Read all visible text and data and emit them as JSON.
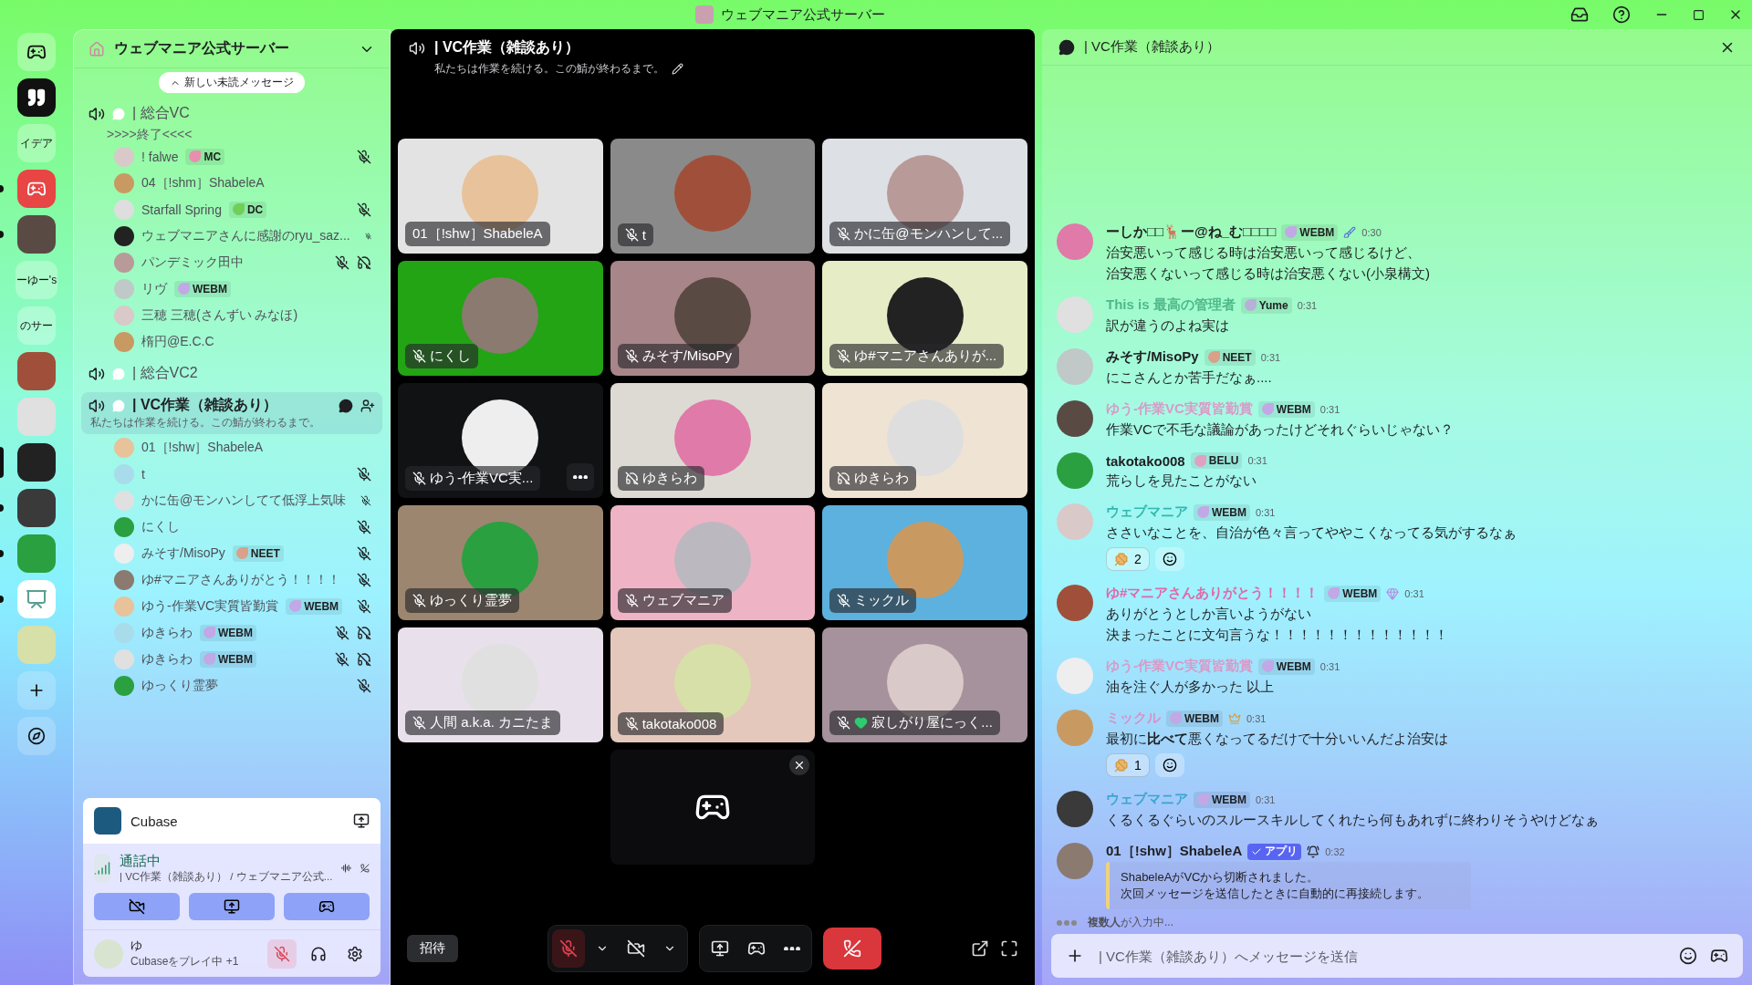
{
  "window": {
    "title": "ウェブマニア公式サーバー"
  },
  "server_rail": {
    "items": [
      {
        "kind": "logo",
        "unread": false,
        "selected": false
      },
      {
        "kind": "quote",
        "unread": false,
        "selected": false
      },
      {
        "kind": "text",
        "label": "イデア",
        "unread": false,
        "selected": false
      },
      {
        "kind": "discord",
        "unread": true,
        "selected": false
      },
      {
        "kind": "picture",
        "unread": true,
        "selected": false
      },
      {
        "kind": "text",
        "label": "ーゆー's",
        "unread": false,
        "selected": false
      },
      {
        "kind": "text",
        "label": "のサー",
        "unread": false,
        "selected": false
      },
      {
        "kind": "picture",
        "unread": false,
        "selected": false
      },
      {
        "kind": "picture",
        "unread": false,
        "selected": false
      },
      {
        "kind": "picture",
        "unread": false,
        "selected": true
      },
      {
        "kind": "picture",
        "unread": true,
        "selected": false
      },
      {
        "kind": "picture",
        "unread": true,
        "selected": false
      },
      {
        "kind": "easel",
        "unread": true,
        "selected": false
      },
      {
        "kind": "picture",
        "unread": false,
        "selected": false
      },
      {
        "kind": "add",
        "unread": false,
        "selected": false
      },
      {
        "kind": "explore",
        "unread": false,
        "selected": false
      }
    ]
  },
  "sidebar": {
    "server_name": "ウェブマニア公式サーバー",
    "unread_pill": "新しい未読メッセージ",
    "channels": [
      {
        "name": "| 総合VC",
        "status": ">>>>終了<<<<",
        "selected": false,
        "members": [
          {
            "name": "! falwe",
            "badge": {
              "kind": "role",
              "label": "MC",
              "color": "#e88fb0"
            },
            "muted": true,
            "deafened": false
          },
          {
            "name": "04［!shm］ShabeleA",
            "muted": false,
            "deafened": false
          },
          {
            "name": "Starfall Spring",
            "badge": {
              "kind": "role",
              "label": "DC",
              "color": "#6fcf5a"
            },
            "muted": true,
            "deafened": false
          },
          {
            "name": "ウェブマニアさんに感謝のryu_saz...",
            "muted": true,
            "deafened": false
          },
          {
            "name": "パンデミック田中",
            "muted": true,
            "deafened": true
          },
          {
            "name": "リヴ",
            "badge": {
              "kind": "role",
              "label": "WEBM",
              "color": "#c2a8e6"
            },
            "muted": false,
            "deafened": false
          },
          {
            "name": "三穂 三穂(さんずい みなほ)",
            "muted": false,
            "deafened": false
          },
          {
            "name": "楕円@E.C.C",
            "muted": false,
            "deafened": false
          }
        ]
      },
      {
        "name": "| 総合VC2",
        "selected": false
      },
      {
        "name": "| VC作業（雑談あり）",
        "status": "私たちは作業を続ける。この鯖が終わるまで。",
        "selected": true,
        "members": [
          {
            "name": "01［!shw］ShabeleA",
            "muted": false,
            "deafened": false
          },
          {
            "name": "t",
            "muted": true,
            "deafened": false
          },
          {
            "name": "かに缶@モンハンしてて低浮上気味",
            "muted": true,
            "deafened": false
          },
          {
            "name": "にくし",
            "muted": true,
            "deafened": false
          },
          {
            "name": "みそす/MisoPy",
            "badge": {
              "kind": "role",
              "label": "NEET",
              "color": "#d9a08a"
            },
            "muted": true,
            "deafened": false
          },
          {
            "name": "ゆ#マニアさんありがとう！！！！",
            "muted": true,
            "deafened": false
          },
          {
            "name": "ゆう-作業VC実質皆勤賞",
            "badge": {
              "kind": "role",
              "label": "WEBM",
              "color": "#c2a8e6"
            },
            "muted": true,
            "deafened": false
          },
          {
            "name": "ゆきらわ",
            "badge": {
              "kind": "role",
              "label": "WEBM",
              "color": "#c2a8e6"
            },
            "muted": true,
            "deafened": true
          },
          {
            "name": "ゆきらわ",
            "badge": {
              "kind": "role",
              "label": "WEBM",
              "color": "#c2a8e6"
            },
            "muted": true,
            "deafened": true
          },
          {
            "name": "ゆっくり霊夢",
            "muted": true,
            "deafened": false
          }
        ]
      }
    ],
    "activity": {
      "name": "Cubase"
    },
    "voice_status": {
      "title": "通話中",
      "location": "| VC作業（雑談あり） / ウェブマニア公式..."
    },
    "user": {
      "name": "ゆ",
      "status": "Cubaseをプレイ中 +1",
      "mic_muted": true
    }
  },
  "video": {
    "title": "| VC作業（雑談あり）",
    "topic": "私たちは作業を続ける。この鯖が終わるまで。",
    "tiles": [
      {
        "name": "01［!shw］ShabeleA",
        "muted": false,
        "deafened": false,
        "heart": false,
        "color": "#e3e3e3",
        "more_button": false
      },
      {
        "name": "t",
        "muted": true,
        "deafened": false,
        "heart": false,
        "color": "#8a8a8a",
        "more_button": false
      },
      {
        "name": "かに缶@モンハンして...",
        "muted": true,
        "deafened": false,
        "heart": false,
        "color": "#dde0e4",
        "more_button": false
      },
      {
        "name": "にくし",
        "muted": true,
        "deafened": false,
        "heart": false,
        "color": "#22a414",
        "more_button": false
      },
      {
        "name": "みそす/MisoPy",
        "muted": true,
        "deafened": false,
        "heart": false,
        "color": "#a88589",
        "more_button": false
      },
      {
        "name": "ゆ#マニアさんありが...",
        "muted": true,
        "deafened": false,
        "heart": false,
        "color": "#e6ecc6",
        "more_button": false
      },
      {
        "name": "ゆう-作業VC実...",
        "muted": true,
        "deafened": false,
        "heart": false,
        "color": "#111214",
        "more_button": true
      },
      {
        "name": "ゆきらわ",
        "muted": false,
        "deafened": true,
        "heart": false,
        "color": "#dddad4",
        "more_button": false
      },
      {
        "name": "ゆきらわ",
        "muted": false,
        "deafened": true,
        "heart": false,
        "color": "#efe3d4",
        "more_button": false
      },
      {
        "name": "ゆっくり霊夢",
        "muted": true,
        "deafened": false,
        "heart": false,
        "color": "#9c8670",
        "more_button": false
      },
      {
        "name": "ウェブマニア",
        "muted": true,
        "deafened": false,
        "heart": false,
        "color": "#efb3c6",
        "more_button": false
      },
      {
        "name": "ミックル",
        "muted": true,
        "deafened": false,
        "heart": false,
        "color": "#5cb1de",
        "more_button": false
      },
      {
        "name": "人間 a.k.a. カニたま",
        "muted": true,
        "deafened": false,
        "heart": false,
        "color": "#e8e0ea",
        "more_button": false
      },
      {
        "name": "takotako008",
        "muted": true,
        "deafened": false,
        "heart": false,
        "color": "#e4c8bb",
        "more_button": false
      },
      {
        "name": "寂しがり屋にっく...",
        "muted": true,
        "deafened": false,
        "heart": true,
        "color": "#a6929c",
        "more_button": false
      }
    ],
    "controls": {
      "invite": "招待",
      "mic_muted": true
    }
  },
  "chat": {
    "title": "| VC作業（雑談あり）",
    "messages": [
      {
        "author": "ーしか□□🦌ー@ね_む□□□□",
        "color": "#1e1f22",
        "badge": {
          "kind": "role",
          "label": "WEBM",
          "color": "#c2a8e6"
        },
        "brush": true,
        "gem": false,
        "crown": false,
        "bell": false,
        "time": "0:30",
        "lines": [
          "治安悪いって感じる時は治安悪いって感じるけど、",
          "治安悪くないって感じる時は治安悪くない(小泉構文)"
        ]
      },
      {
        "author": "This is 最高の管理者",
        "color": "#4fb88a",
        "badge": {
          "kind": "role",
          "label": "Yume",
          "color": "#b8b0d8"
        },
        "brush": false,
        "gem": false,
        "crown": false,
        "bell": false,
        "time": "0:31",
        "lines": [
          "訳が違うのよね実は"
        ]
      },
      {
        "author": "みそす/MisoPy",
        "color": "#1e1f22",
        "badge": {
          "kind": "role",
          "label": "NEET",
          "color": "#d9a08a"
        },
        "brush": false,
        "gem": false,
        "crown": false,
        "bell": false,
        "time": "0:31",
        "lines": [
          "にこさんとか苦手だなぁ...."
        ]
      },
      {
        "author": "ゆう-作業VC実質皆勤賞",
        "color": "#d99ac8",
        "badge": {
          "kind": "role",
          "label": "WEBM",
          "color": "#c2a8e6"
        },
        "brush": false,
        "gem": false,
        "crown": false,
        "bell": false,
        "time": "0:31",
        "lines": [
          "作業VCで不毛な議論があったけどそれぐらいじゃない？"
        ]
      },
      {
        "author": "takotako008",
        "color": "#1e1f22",
        "badge": {
          "kind": "role",
          "label": "BELU",
          "color": "#e0a0c0"
        },
        "brush": false,
        "gem": false,
        "crown": false,
        "bell": false,
        "time": "0:31",
        "lines": [
          "荒らしを見たことがない"
        ]
      },
      {
        "author": "ウェブマニア",
        "color": "#32b8b0",
        "badge": {
          "kind": "role",
          "label": "WEBM",
          "color": "#c2a8e6"
        },
        "brush": false,
        "gem": false,
        "crown": false,
        "bell": false,
        "time": "0:31",
        "lines": [
          "ささいなことを、自治が色々言ってややこくなってる気がするなぁ"
        ],
        "reactions": [
          {
            "count": "2"
          }
        ]
      },
      {
        "author": "ゆ#マニアさんありがとう！！！！",
        "color": "#de6aa8",
        "badge": {
          "kind": "role",
          "label": "WEBM",
          "color": "#c2a8e6"
        },
        "brush": false,
        "gem": true,
        "crown": false,
        "bell": false,
        "time": "0:31",
        "lines": [
          "ありがとうとしか言いようがない",
          "決まったことに文句言うな！！！！！！！！！！！！！"
        ]
      },
      {
        "author": "ゆう-作業VC実質皆勤賞",
        "color": "#d99ac8",
        "badge": {
          "kind": "role",
          "label": "WEBM",
          "color": "#c2a8e6"
        },
        "brush": false,
        "gem": false,
        "crown": false,
        "bell": false,
        "time": "0:31",
        "lines": [
          "油を注ぐ人が多かった 以上"
        ]
      },
      {
        "author": "ミックル",
        "color": "#d792c8",
        "badge": {
          "kind": "role",
          "label": "WEBM",
          "color": "#c2a8e6"
        },
        "brush": false,
        "gem": false,
        "crown": true,
        "bell": false,
        "time": "0:31",
        "lines": [
          "最初に**比べて**悪くなってるだけで十分いいんだよ治安は"
        ],
        "reactions": [
          {
            "count": "1"
          }
        ]
      },
      {
        "author": "ウェブマニア",
        "color": "#3aa6d0",
        "badge": {
          "kind": "role",
          "label": "WEBM",
          "color": "#c2a8e6"
        },
        "brush": false,
        "gem": false,
        "crown": false,
        "bell": false,
        "time": "0:31",
        "lines": [
          "くるくるぐらいのスルースキルしてくれたら何もあれずに終わりそうやけどなぁ"
        ]
      },
      {
        "author": "01［!shw］ShabeleA",
        "color": "#1e1f22",
        "badge": {
          "kind": "app",
          "label": "アプリ",
          "color": "#5865f2"
        },
        "brush": false,
        "gem": false,
        "crown": false,
        "bell": true,
        "time": "0:32",
        "embed": [
          "ShabeleAがVCから切断されました。",
          "次回メッセージを送信したときに自動的に再接続します。"
        ]
      }
    ],
    "typing": "**複数人**が入力中...",
    "input": {
      "placeholder": "| VC作業（雑談あり）へメッセージを送信"
    }
  }
}
